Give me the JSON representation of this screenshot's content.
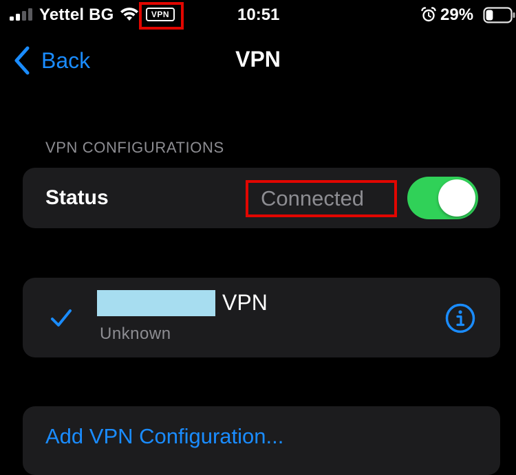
{
  "status_bar": {
    "carrier": "Yettel BG",
    "vpn_badge": "VPN",
    "time": "10:51",
    "battery_percent": "29%",
    "battery_level": 0.29
  },
  "nav": {
    "back_label": "Back",
    "title": "VPN"
  },
  "section": {
    "header": "VPN CONFIGURATIONS"
  },
  "status_row": {
    "label": "Status",
    "value": "Connected",
    "toggle_on": true
  },
  "vpn_item": {
    "name": "VPN",
    "subtitle": "Unknown",
    "selected": true
  },
  "add_config": {
    "label": "Add VPN Configuration..."
  },
  "colors": {
    "background": "#000000",
    "card": "#1c1c1e",
    "accent": "#1a8cff",
    "toggle_on": "#30d158",
    "secondary_text": "#8d8d92",
    "highlight_box": "#e10600",
    "redaction": "#a7ddf0"
  },
  "icons": {
    "signal": "cellular-signal-icon",
    "wifi": "wifi-icon",
    "alarm": "alarm-clock-icon",
    "battery": "battery-icon",
    "back": "chevron-left-icon",
    "check": "checkmark-icon",
    "info": "info-circle-icon"
  }
}
